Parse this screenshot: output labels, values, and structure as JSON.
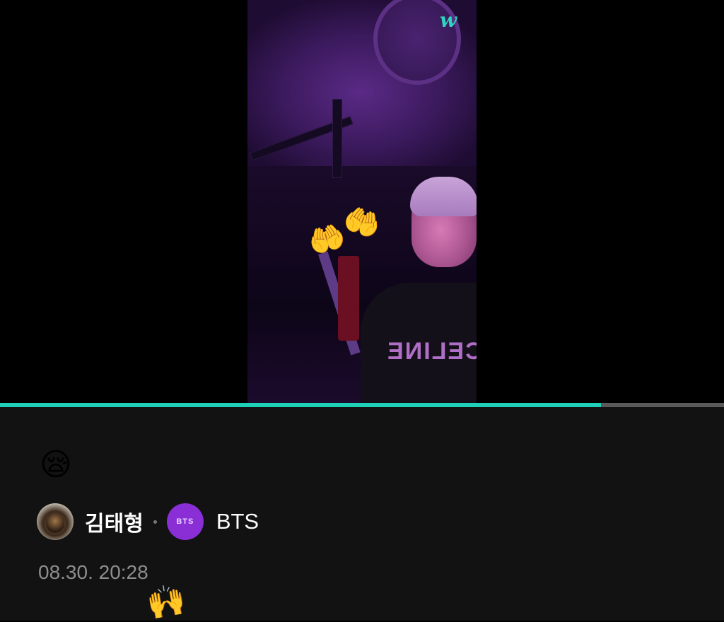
{
  "video": {
    "brand_logo": "w",
    "overlay_icons": [
      "raising-hands-icon",
      "raising-hands-icon"
    ],
    "accent_color": "#1fd0b8"
  },
  "playback": {
    "progress_fraction": 0.83
  },
  "post": {
    "emoji": "😪",
    "author_name": "김태형",
    "community_badge": "BTS",
    "community_name": "BTS",
    "timestamp": "08.30. 20:28"
  },
  "decorations": {
    "video_hands": "🤲",
    "timestamp_hands": "🙌"
  }
}
